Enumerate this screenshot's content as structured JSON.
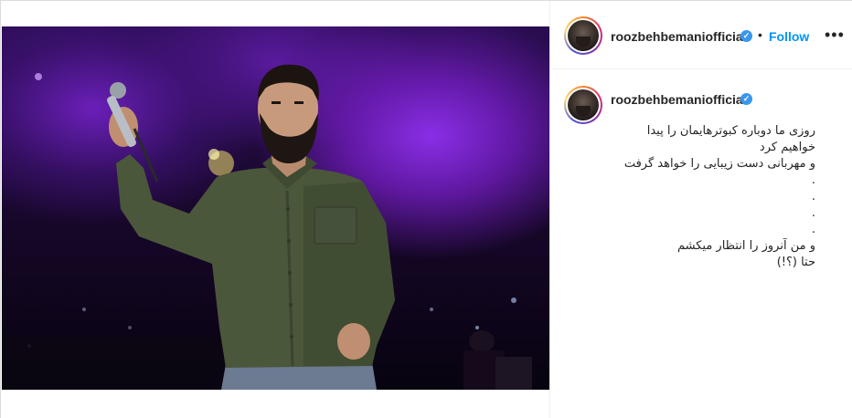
{
  "header": {
    "username": "roozbehbemaniofficial",
    "verified_icon": "verified-badge-icon",
    "separator": "•",
    "follow_label": "Follow",
    "more_label": "•••"
  },
  "caption": {
    "username": "roozbehbemaniofficial",
    "text": "روزی ما دوباره کبوترهایمان را پیدا\nخواهیم کرد\nو مهربانی دست زیبایی را خواهد گرفت\n.\n.\n.\n.\nو من آنروز را انتظار میکشم\nحتا (؟!)"
  },
  "colors": {
    "accent": "#0095f6",
    "verified": "#3897f0",
    "stage_purple": "#8a2ee6",
    "shirt_green": "#4a5a3a"
  }
}
